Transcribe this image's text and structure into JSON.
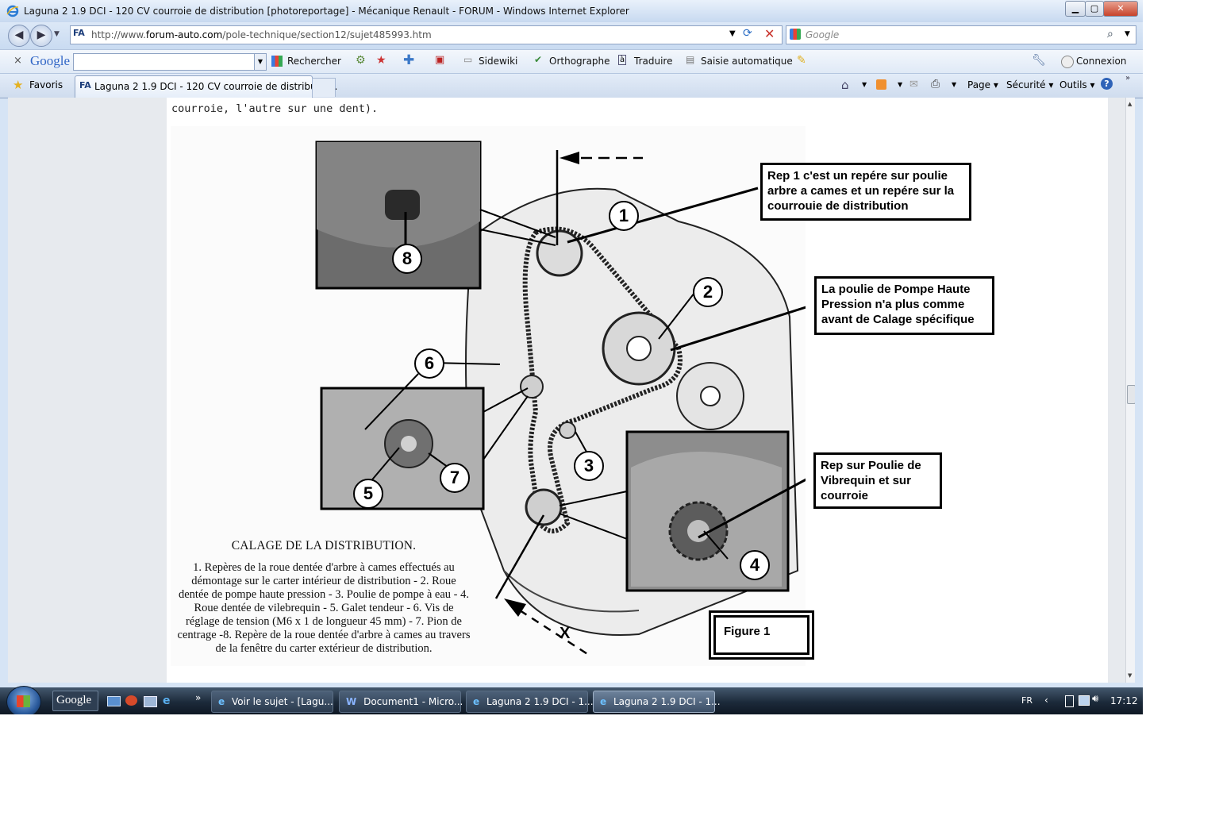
{
  "window": {
    "title": "Laguna 2 1.9 DCI - 120 CV courroie de distribution [photoreportage] - Mécanique Renault - FORUM - Windows Internet Explorer"
  },
  "address_bar": {
    "url_prefix": "http://www.",
    "url_domain": "forum-auto.com",
    "url_path": "/pole-technique/section12/sujet485993.htm",
    "search_placeholder": "Google"
  },
  "google_toolbar": {
    "logo": "Google",
    "items": [
      "Rechercher",
      "Sidewiki",
      "Orthographe",
      "Traduire",
      "Saisie automatique",
      "Connexion"
    ]
  },
  "favorites_bar": {
    "favorites_label": "Favoris",
    "tab_title": "Laguna 2 1.9 DCI - 120 CV courroie de distributio...",
    "commands": [
      "Page",
      "Sécurité",
      "Outils"
    ]
  },
  "page": {
    "text_line": "courroie, l'autre sur une dent).",
    "figure": {
      "callout_1": "Rep 1 c'est un repére sur poulie arbre a cames et un repére sur la courrouie de distribution",
      "callout_2": "La poulie de Pompe Haute Pression n'a plus comme avant de Calage spécifique",
      "callout_3": "Rep sur Poulie de Vibrequin et sur courroie",
      "figure_label": "Figure 1",
      "caption_title": "CALAGE DE LA DISTRIBUTION.",
      "caption_body": "1. Repères de la roue dentée d'arbre à cames effectués au démontage sur le carter intérieur de distribution - 2. Roue dentée de pompe haute pression - 3. Poulie de pompe à eau - 4. Roue dentée de vilebrequin - 5. Galet tendeur - 6. Vis de réglage de tension (M6 x 1 de longueur 45 mm) - 7. Pion de centrage -8. Repère de la roue dentée d'arbre à cames au travers de la fenêtre du carter extérieur de distribution.",
      "numbers": [
        "1",
        "2",
        "3",
        "4",
        "5",
        "6",
        "7",
        "8"
      ],
      "axis_mark": "X"
    }
  },
  "taskbar": {
    "quicklaunch_google": "Google",
    "tasks": [
      "Voir le sujet - [Lagu...",
      "Document1 - Micro...",
      "Laguna 2 1.9 DCI - 1...",
      "Laguna 2 1.9 DCI - 1..."
    ],
    "language": "FR",
    "clock": "17:12"
  }
}
